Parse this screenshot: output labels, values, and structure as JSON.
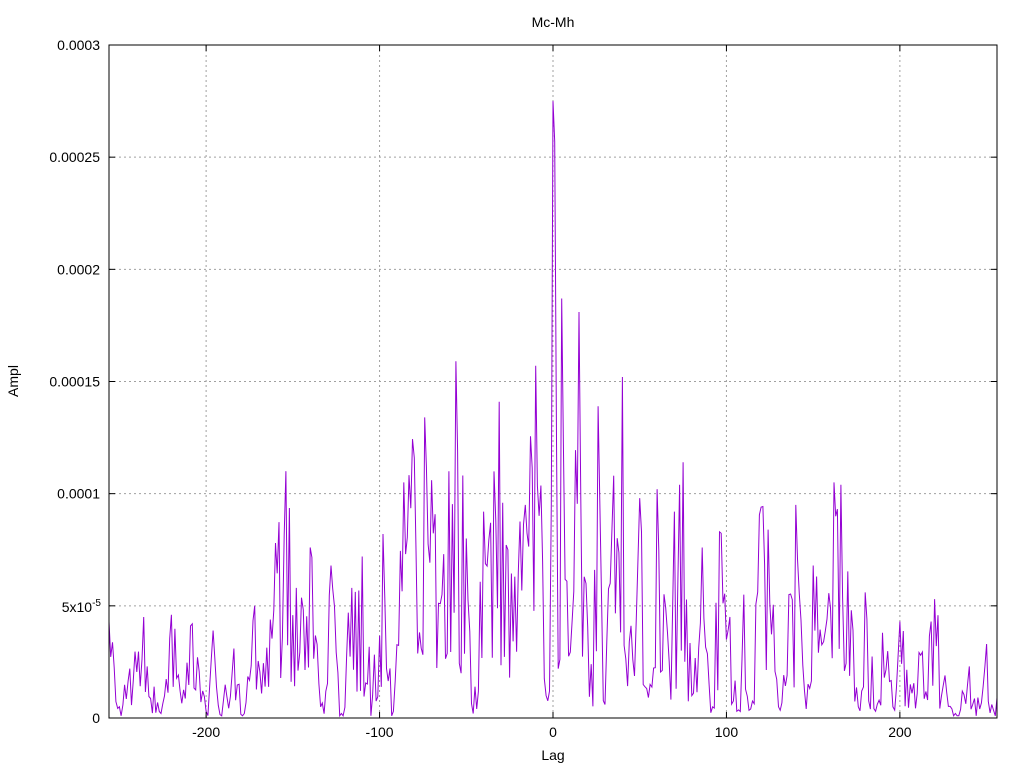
{
  "chart_data": {
    "type": "line",
    "title": "Mc-Mh",
    "xlabel": "Lag",
    "ylabel": "Ampl",
    "xlim": [
      -256,
      256
    ],
    "ylim": [
      0,
      0.0003
    ],
    "grid": true,
    "x_ticks": [
      {
        "value": -200,
        "label": "-200"
      },
      {
        "value": -100,
        "label": "-100"
      },
      {
        "value": 0,
        "label": "0"
      },
      {
        "value": 100,
        "label": "100"
      },
      {
        "value": 200,
        "label": "200"
      }
    ],
    "y_ticks": [
      {
        "value": 0,
        "label": "0"
      },
      {
        "value": 5e-05,
        "label": "5x10",
        "exp": "-5"
      },
      {
        "value": 0.0001,
        "label": "0.0001"
      },
      {
        "value": 0.00015,
        "label": "0.00015"
      },
      {
        "value": 0.0002,
        "label": "0.0002"
      },
      {
        "value": 0.00025,
        "label": "0.00025"
      },
      {
        "value": 0.0003,
        "label": "0.0003"
      }
    ],
    "series": [
      {
        "color": "#9400d3",
        "peaks": [
          [
            -256,
            4.3e-05
          ],
          [
            -250,
            5e-06
          ],
          [
            -244,
            2.2e-05
          ],
          [
            -236,
            4.5e-05
          ],
          [
            -230,
            1.4e-05
          ],
          [
            -226,
            2e-06
          ],
          [
            -220,
            4.6e-05
          ],
          [
            -215,
            1.2e-05
          ],
          [
            -208,
            4.2e-05
          ],
          [
            -200,
            3e-06
          ],
          [
            -196,
            3.9e-05
          ],
          [
            -190,
            8e-06
          ],
          [
            -184,
            3.1e-05
          ],
          [
            -178,
            2e-06
          ],
          [
            -172,
            5e-05
          ],
          [
            -166,
            1.4e-05
          ],
          [
            -160,
            7.8e-05
          ],
          [
            -154,
            0.00011
          ],
          [
            -148,
            5.8e-05
          ],
          [
            -140,
            7.6e-05
          ],
          [
            -134,
            5e-06
          ],
          [
            -128,
            6.8e-05
          ],
          [
            -122,
            2e-06
          ],
          [
            -116,
            5.8e-05
          ],
          [
            -110,
            7.2e-05
          ],
          [
            -104,
            1e-05
          ],
          [
            -98,
            8.2e-05
          ],
          [
            -92,
            3e-06
          ],
          [
            -86,
            0.000105
          ],
          [
            -80,
            0.000116
          ],
          [
            -74,
            0.000134
          ],
          [
            -70,
            0.000106
          ],
          [
            -64,
            5.5e-05
          ],
          [
            -60,
            0.00011
          ],
          [
            -56,
            0.000159
          ],
          [
            -50,
            8e-05
          ],
          [
            -46,
            2e-06
          ],
          [
            -40,
            9.2e-05
          ],
          [
            -36,
            8.7e-05
          ],
          [
            -31,
            0.000141
          ],
          [
            -26,
            7.5e-05
          ],
          [
            -20,
            6.5e-05
          ],
          [
            -16,
            9.5e-05
          ],
          [
            -10,
            0.000157
          ],
          [
            -6,
            7e-05
          ],
          [
            -4,
            1e-05
          ],
          [
            -2,
            1.2e-05
          ],
          [
            0,
            0.000275
          ],
          [
            1,
            0.000257
          ],
          [
            3,
            2.2e-05
          ],
          [
            5,
            0.000187
          ],
          [
            8,
            6.1e-05
          ],
          [
            11,
            4.3e-05
          ],
          [
            15,
            0.000181
          ],
          [
            18,
            6.3e-05
          ],
          [
            22,
            2.4e-05
          ],
          [
            26,
            0.000139
          ],
          [
            30,
            6e-06
          ],
          [
            35,
            0.000108
          ],
          [
            40,
            0.000152
          ],
          [
            44,
            3.4e-05
          ],
          [
            50,
            9.8e-05
          ],
          [
            56,
            1.5e-05
          ],
          [
            60,
            0.000102
          ],
          [
            66,
            3.8e-05
          ],
          [
            70,
            9.2e-05
          ],
          [
            75,
            0.000114
          ],
          [
            80,
            1e-05
          ],
          [
            86,
            7.6e-05
          ],
          [
            92,
            5e-06
          ],
          [
            96,
            8.3e-05
          ],
          [
            102,
            4.5e-05
          ],
          [
            106,
            3e-06
          ],
          [
            110,
            5.5e-05
          ],
          [
            114,
            4e-06
          ],
          [
            120,
            9.4e-05
          ],
          [
            124,
            8.4e-05
          ],
          [
            130,
            5e-06
          ],
          [
            136,
            5.5e-05
          ],
          [
            140,
            9.5e-05
          ],
          [
            146,
            4e-06
          ],
          [
            150,
            6.8e-05
          ],
          [
            156,
            3.4e-05
          ],
          [
            162,
            0.000105
          ],
          [
            166,
            0.000104
          ],
          [
            172,
            4.8e-05
          ],
          [
            176,
            5e-06
          ],
          [
            180,
            5.6e-05
          ],
          [
            186,
            3e-06
          ],
          [
            190,
            3.8e-05
          ],
          [
            196,
            5e-06
          ],
          [
            200,
            4.3e-05
          ],
          [
            206,
            1.5e-05
          ],
          [
            212,
            2.8e-05
          ],
          [
            218,
            4.3e-05
          ],
          [
            220,
            5.3e-05
          ],
          [
            226,
            1.9e-05
          ],
          [
            232,
            2e-06
          ],
          [
            236,
            1.2e-05
          ],
          [
            240,
            2.3e-05
          ],
          [
            246,
            4e-06
          ],
          [
            250,
            3.3e-05
          ],
          [
            253,
            6e-06
          ],
          [
            256,
            9e-06
          ]
        ]
      }
    ]
  }
}
